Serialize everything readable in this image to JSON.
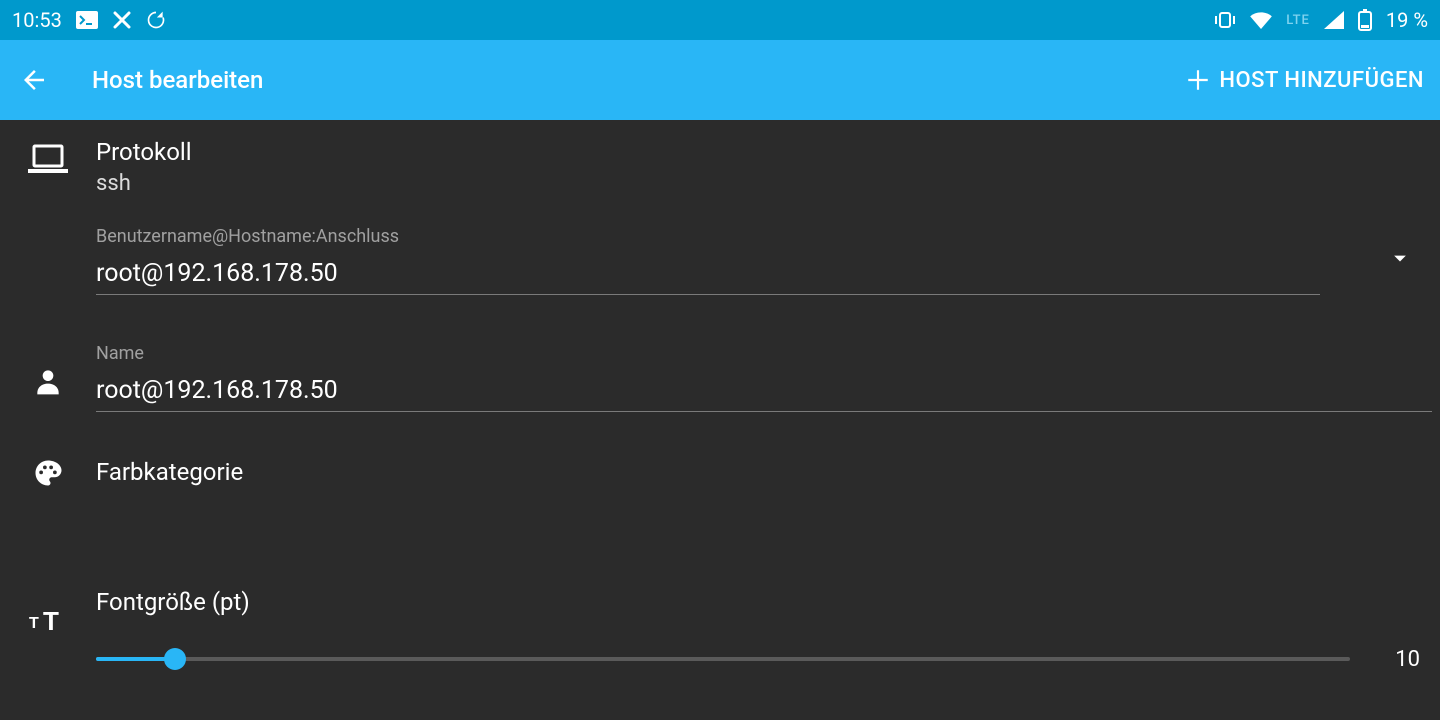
{
  "status": {
    "time": "10:53",
    "network_label": "LTE",
    "battery_text": "19 %"
  },
  "appbar": {
    "title": "Host bearbeiten",
    "action_label": "HOST HINZUFÜGEN"
  },
  "protocol": {
    "label": "Protokoll",
    "value": "ssh"
  },
  "connection": {
    "label": "Benutzername@Hostname:Anschluss",
    "value": "root@192.168.178.50"
  },
  "name": {
    "label": "Name",
    "value": "root@192.168.178.50"
  },
  "color": {
    "label": "Farbkategorie"
  },
  "font": {
    "label": "Fontgröße (pt)",
    "value": "10",
    "percent": 6.3
  }
}
